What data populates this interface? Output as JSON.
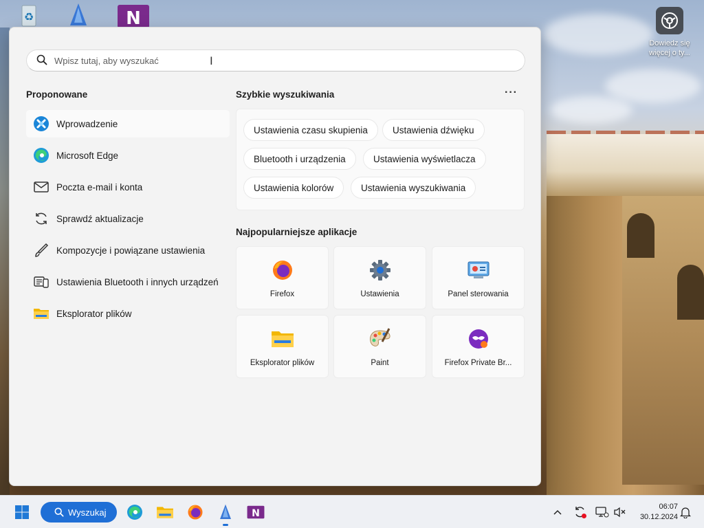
{
  "desktop": {
    "tip_text_line1": "Dowiedz się",
    "tip_text_line2": "więcej o ty..."
  },
  "search": {
    "placeholder": "Wpisz tutaj, aby wyszukać"
  },
  "suggested": {
    "heading": "Proponowane",
    "items": [
      {
        "label": "Wprowadzenie",
        "icon": "get-started-icon"
      },
      {
        "label": "Microsoft Edge",
        "icon": "edge-icon"
      },
      {
        "label": "Poczta e-mail i konta",
        "icon": "mail-icon"
      },
      {
        "label": "Sprawdź aktualizacje",
        "icon": "refresh-icon"
      },
      {
        "label": "Kompozycje i powiązane ustawienia",
        "icon": "brush-icon"
      },
      {
        "label": "Ustawienia Bluetooth i innych urządzeń",
        "icon": "devices-icon"
      },
      {
        "label": "Eksplorator plików",
        "icon": "folder-icon"
      }
    ]
  },
  "quick_searches": {
    "heading": "Szybkie wyszukiwania",
    "more": "···",
    "chips": [
      "Ustawienia czasu skupienia",
      "Ustawienia dźwięku",
      "Bluetooth i urządzenia",
      "Ustawienia wyświetlacza",
      "Ustawienia kolorów",
      "Ustawienia wyszukiwania"
    ]
  },
  "top_apps": {
    "heading": "Najpopularniejsze aplikacje",
    "apps": [
      {
        "label": "Firefox",
        "icon": "firefox-icon"
      },
      {
        "label": "Ustawienia",
        "icon": "settings-gear-icon"
      },
      {
        "label": "Panel sterowania",
        "icon": "control-panel-icon"
      },
      {
        "label": "Eksplorator plików",
        "icon": "folder-icon"
      },
      {
        "label": "Paint",
        "icon": "paint-palette-icon"
      },
      {
        "label": "Firefox Private Br...",
        "icon": "firefox-private-icon"
      }
    ]
  },
  "taskbar": {
    "search_label": "Wyszukaj",
    "time": "06:07",
    "date": "30.12.2024"
  },
  "colors": {
    "accent": "#1f6fd6",
    "panel_bg": "#f3f3f3"
  }
}
